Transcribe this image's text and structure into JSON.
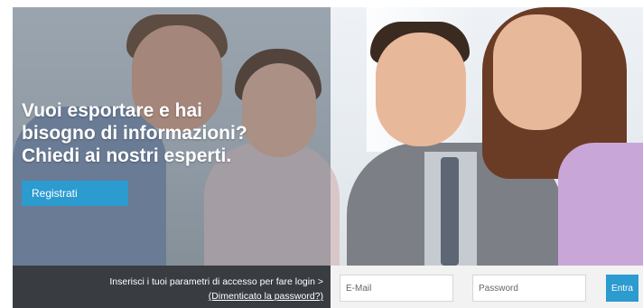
{
  "hero": {
    "headline_lines": [
      "Vuoi esportare e hai",
      "bisogno di informazioni?",
      "Chiedi ai nostri esperti."
    ],
    "register_label": "Registrati"
  },
  "login": {
    "message": "Inserisci i tuoi parametri di accesso per fare login >",
    "forgot_label": "(Dimenticato la password?)",
    "email_placeholder": "E-Mail",
    "password_placeholder": "Password",
    "submit_label": "Entra"
  },
  "colors": {
    "accent": "#2b9bd0",
    "login_bar_dark": "#282c32",
    "login_bar_light": "#f2f2f2"
  }
}
